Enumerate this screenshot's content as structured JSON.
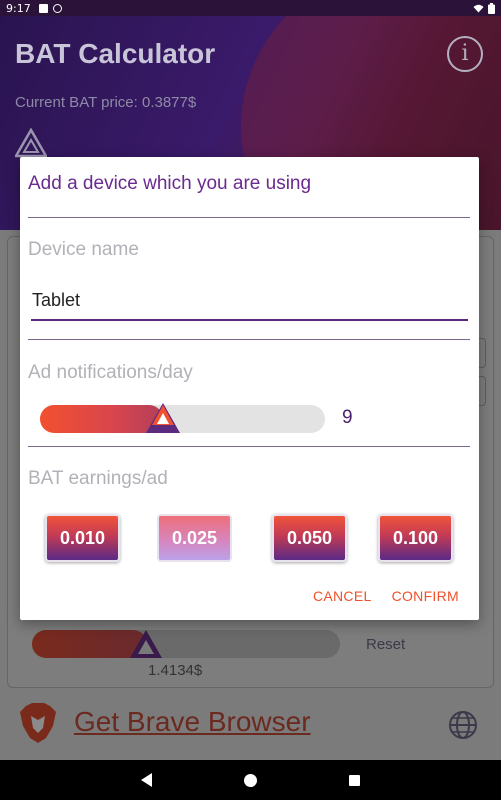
{
  "status_bar": {
    "time": "9:17"
  },
  "header": {
    "title": "BAT Calculator",
    "price_text": "Current BAT price: 0.3877$",
    "info_icon": "i"
  },
  "background": {
    "reset_label": "Reset",
    "total_value": "1.4134$",
    "footer_link": "Get Brave Browser"
  },
  "dialog": {
    "title": "Add a device which you are using",
    "device_name_label": "Device name",
    "device_name_value": "Tablet",
    "ad_notifications_label": "Ad notifications/day",
    "ad_notifications_value": "9",
    "ad_notifications_fraction": 0.43,
    "earnings_label": "BAT earnings/ad",
    "earnings_options": [
      {
        "label": "0.010",
        "selected": false
      },
      {
        "label": "0.025",
        "selected": true
      },
      {
        "label": "0.050",
        "selected": false
      },
      {
        "label": "0.100",
        "selected": false
      }
    ],
    "cancel_label": "CANCEL",
    "confirm_label": "CONFIRM"
  },
  "colors": {
    "accent": "#f1502a",
    "brand_purple": "#6a2a8e"
  },
  "icons": [
    "wifi-icon",
    "battery-icon",
    "info-icon",
    "bat-logo-icon",
    "brave-lion-icon",
    "globe-icon"
  ]
}
